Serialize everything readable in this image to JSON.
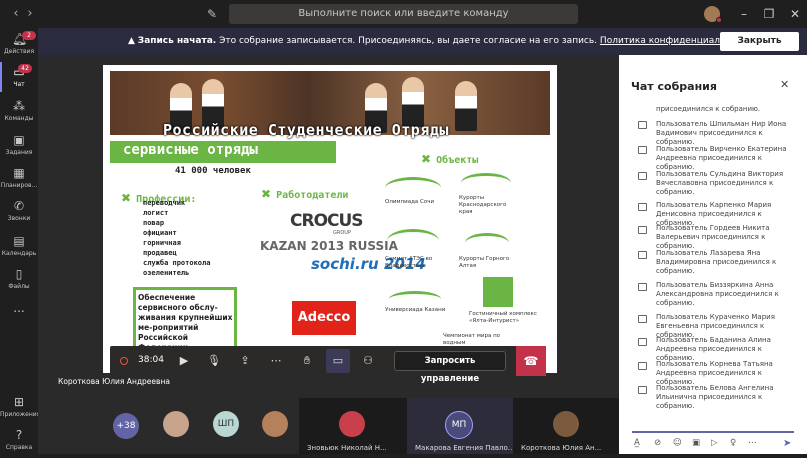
{
  "search": {
    "placeholder": "Выполните поиск или введите команду"
  },
  "rail": {
    "items": [
      {
        "label": "Действия",
        "icon": "bell-icon",
        "badge": "2"
      },
      {
        "label": "Чат",
        "icon": "chat-icon",
        "badge": "42"
      },
      {
        "label": "Команды",
        "icon": "teams-icon"
      },
      {
        "label": "Задания",
        "icon": "assignments-icon"
      },
      {
        "label": "Планиров...",
        "icon": "planner-icon"
      },
      {
        "label": "Звонки",
        "icon": "phone-icon"
      },
      {
        "label": "Календарь",
        "icon": "calendar-icon"
      },
      {
        "label": "Файлы",
        "icon": "files-icon"
      },
      {
        "label": "...",
        "icon": "more-icon"
      }
    ],
    "apps_label": "Приложения",
    "help_label": "Справка"
  },
  "banner": {
    "bold": "Запись начата.",
    "text": " Это собрание записывается. Присоединяясь, вы даете согласие на его запись. ",
    "link": "Политика конфиденциальности",
    "close_label": "Закрыть"
  },
  "slide": {
    "title": "Российские Студенческие Отряды",
    "section": "сервисные отряды",
    "count": "41 000 человек",
    "professions_heading": "Профессии:",
    "professions": [
      "переводчик",
      "логист",
      "повар",
      "официант",
      "горничная",
      "продавец",
      "служба протокола",
      "озеленитель"
    ],
    "employers_heading": "Работодатели",
    "objects_heading": "Объекты",
    "box_text": "Обеспечение сервисного обслу-живания крупнейших ме-роприятий Российской Федерации.",
    "employers": [
      "CROCUS",
      "GROUP",
      "KAZAN 2013 RUSSIA",
      "sochi.ru 2014",
      "Adecco"
    ],
    "objects": [
      "Олимпиада Сочи",
      "Курорты Краснодарского края",
      "Саммит АТЭС во Владивостоке",
      "Курорты Горного Алтая",
      "Универсиада Казани",
      "Гостиничный комплекс «Ялта-Интурист»",
      "Чемпионат мира по водным"
    ]
  },
  "controls": {
    "timer": "38:04",
    "request_control": "Запросить управление"
  },
  "presenter": "Короткова Юлия Андреевна",
  "participants": {
    "overflow": "+38",
    "tiles": [
      {
        "initials": "ШП"
      },
      {
        "name": "Зновьюк Николай Н..."
      },
      {
        "name": "Макарова Евгения Павло...",
        "initials": "МП"
      },
      {
        "name": "Короткова Юлия Ан..."
      }
    ]
  },
  "chat": {
    "title": "Чат собрания",
    "messages": [
      "присоединился к собранию.",
      "Пользователь Шпильман Нир Иона Вадимович присоединился к собранию.",
      "Пользователь Вирченко Екатерина Андреевна присоединился к собранию.",
      "Пользователь Сульдина Виктория Вячеславовна присоединился к собранию.",
      "Пользователь Карпенко Мария Денисовна присоединился к собранию.",
      "Пользователь Гордеев Никита Валерьевич присоединился к собранию.",
      "Пользователь Лазарева Яна Владимировна присоединился к собранию.",
      "Пользователь Биззяркина Анна Александровна присоединился к собранию.",
      "Пользователь Кураченко Мария Евгеньевна присоединился к собранию.",
      "Пользователь Баданина Алина Андреевна присоединился к собранию.",
      "Пользователь Корнева Татьяна Андреевна присоединился к собранию.",
      "Пользователь Белова Ангелина Ильинична присоединился к собранию."
    ]
  }
}
